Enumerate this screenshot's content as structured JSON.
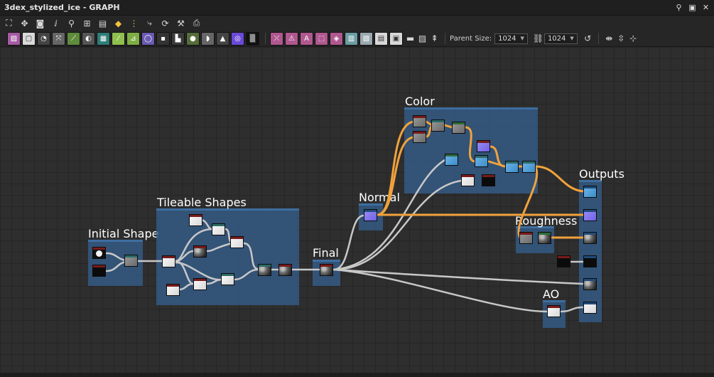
{
  "window": {
    "title": "3dex_stylized_ice - GRAPH"
  },
  "toolbar": {
    "parent_size_label": "Parent Size:",
    "parent_size_value": "1024",
    "output_size_value": "1024"
  },
  "frames": {
    "initial_shape": "Initial Shape",
    "tileable_shapes": "Tileable Shapes",
    "final": "Final",
    "normal": "Normal",
    "color": "Color",
    "roughness": "Roughness",
    "ao": "AO",
    "outputs": "Outputs"
  },
  "colors": {
    "frame_fill": "#345e8c",
    "link_gray": "#c8c8c8",
    "link_orange": "#f0a23c",
    "canvas_bg": "#2e2e2e"
  }
}
